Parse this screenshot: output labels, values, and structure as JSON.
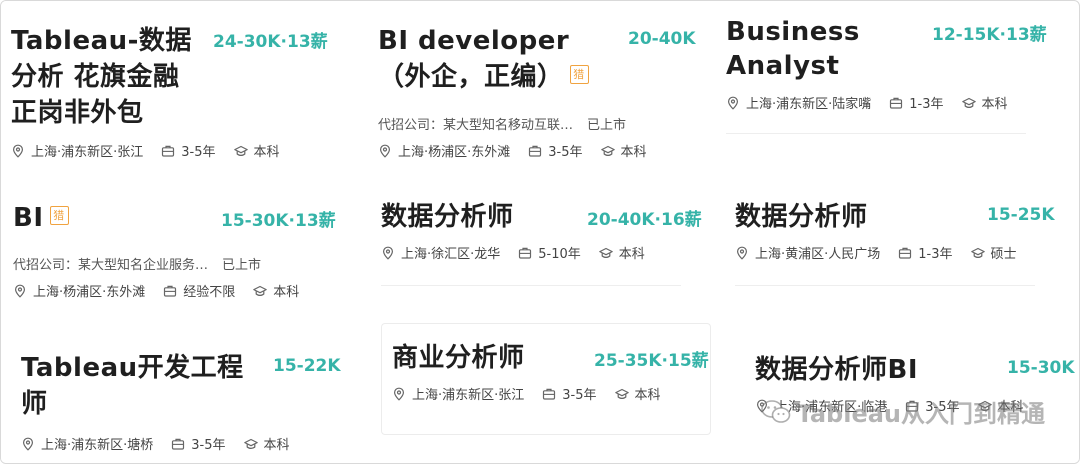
{
  "colors": {
    "salary": "#36b3a8",
    "badge": "#f0a340"
  },
  "cards": [
    {
      "title": "Tableau-数据分析 花旗金融正岗非外包",
      "salary": "24-30K·13薪",
      "location": "上海·浦东新区·张江",
      "experience": "3-5年",
      "education": "本科"
    },
    {
      "title": "BI developer （外企，正编）",
      "badge": "猎",
      "salary": "20-40K",
      "agency": "代招公司：某大型知名移动互联…",
      "listed": "已上市",
      "location": "上海·杨浦区·东外滩",
      "experience": "3-5年",
      "education": "本科"
    },
    {
      "title": "Business Analyst",
      "salary": "12-15K·13薪",
      "location": "上海·浦东新区·陆家嘴",
      "experience": "1-3年",
      "education": "本科"
    },
    {
      "title": "BI",
      "badge": "猎",
      "salary": "15-30K·13薪",
      "agency": "代招公司：某大型知名企业服务…",
      "listed": "已上市",
      "location": "上海·杨浦区·东外滩",
      "experience": "经验不限",
      "education": "本科"
    },
    {
      "title": "数据分析师",
      "salary": "20-40K·16薪",
      "location": "上海·徐汇区·龙华",
      "experience": "5-10年",
      "education": "本科"
    },
    {
      "title": "数据分析师",
      "salary": "15-25K",
      "location": "上海·黄浦区·人民广场",
      "experience": "1-3年",
      "education": "硕士"
    },
    {
      "title": "Tableau开发工程师",
      "salary": "15-22K",
      "location": "上海·浦东新区·塘桥",
      "experience": "3-5年",
      "education": "本科"
    },
    {
      "title": "商业分析师",
      "salary": "25-35K·15薪",
      "location": "上海·浦东新区·张江",
      "experience": "3-5年",
      "education": "本科"
    },
    {
      "title": "数据分析师BI",
      "salary": "15-30K",
      "location": "上海·浦东新区·临港",
      "experience": "3-5年",
      "education": "本科"
    }
  ],
  "watermark": {
    "icon": "wechat-icon",
    "text": "Tableau从入门到精通"
  }
}
